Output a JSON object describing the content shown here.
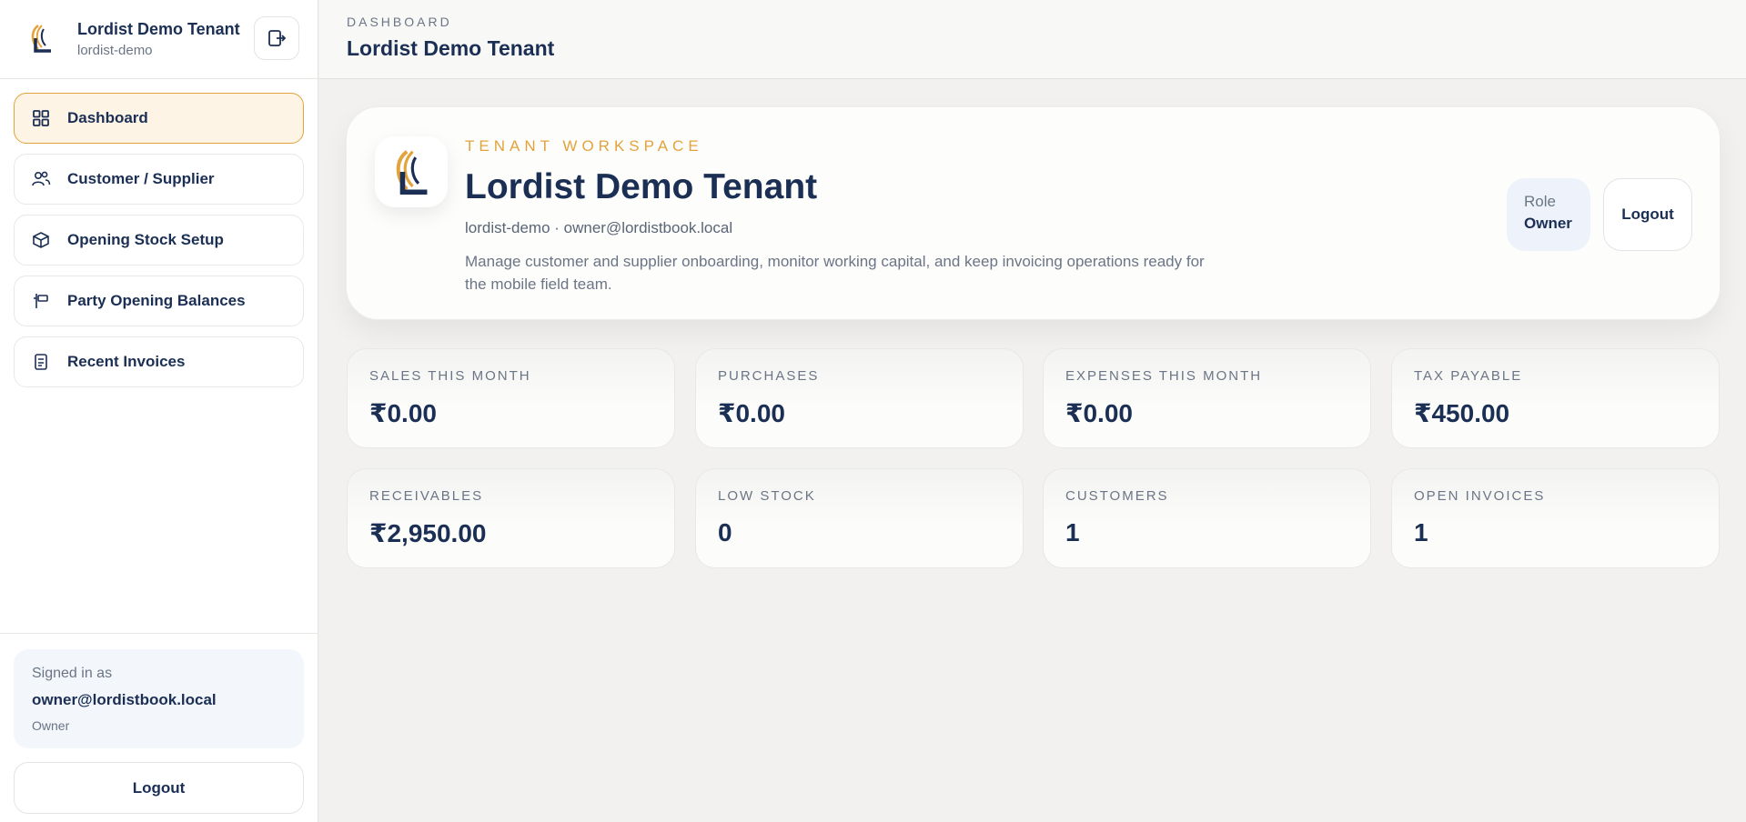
{
  "sidebar": {
    "tenant_name": "Lordist Demo Tenant",
    "tenant_slug": "lordist-demo",
    "nav": [
      {
        "label": "Dashboard",
        "icon": "grid-icon",
        "active": true
      },
      {
        "label": "Customer / Supplier",
        "icon": "users-icon"
      },
      {
        "label": "Opening Stock Setup",
        "icon": "box-icon"
      },
      {
        "label": "Party Opening Balances",
        "icon": "signpost-icon"
      },
      {
        "label": "Recent Invoices",
        "icon": "receipt-icon"
      }
    ],
    "signed_in_label": "Signed in as",
    "signed_in_email": "owner@lordistbook.local",
    "signed_in_role": "Owner",
    "logout_label": "Logout"
  },
  "topbar": {
    "eyebrow": "DASHBOARD",
    "title": "Lordist Demo Tenant"
  },
  "hero": {
    "eyebrow": "TENANT WORKSPACE",
    "title": "Lordist Demo Tenant",
    "meta": "lordist-demo · owner@lordistbook.local",
    "description": "Manage customer and supplier onboarding, monitor working capital, and keep invoicing operations ready for the mobile field team.",
    "role_label": "Role",
    "role_value": "Owner",
    "logout_label": "Logout"
  },
  "stats": [
    {
      "label": "SALES THIS MONTH",
      "value": "₹0.00"
    },
    {
      "label": "PURCHASES",
      "value": "₹0.00"
    },
    {
      "label": "EXPENSES THIS MONTH",
      "value": "₹0.00"
    },
    {
      "label": "TAX PAYABLE",
      "value": "₹450.00"
    },
    {
      "label": "RECEIVABLES",
      "value": "₹2,950.00"
    },
    {
      "label": "LOW STOCK",
      "value": "0"
    },
    {
      "label": "CUSTOMERS",
      "value": "1"
    },
    {
      "label": "OPEN INVOICES",
      "value": "1"
    }
  ],
  "colors": {
    "accent": "#e3a33c",
    "navy": "#1b2f55",
    "muted": "#6b7585"
  }
}
